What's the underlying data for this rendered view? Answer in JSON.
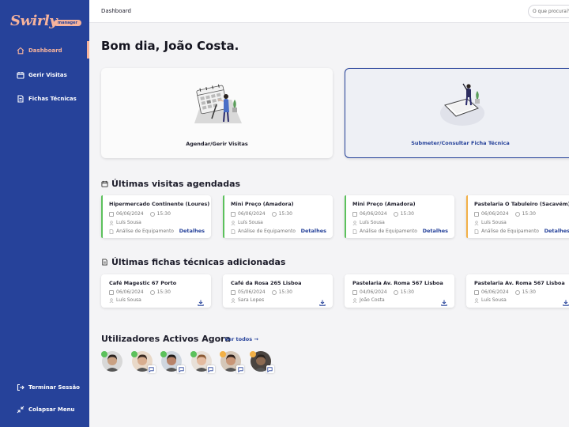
{
  "app": {
    "logo": "Swirly",
    "badge": "manager"
  },
  "colors": {
    "brand": "#26429a",
    "accent": "#f6b39c",
    "green": "#5cc15c",
    "orange": "#f2b046"
  },
  "sidebar": {
    "items": [
      {
        "label": "Dashboard",
        "icon": "home-icon"
      },
      {
        "label": "Gerir Visitas",
        "icon": "calendar-icon"
      },
      {
        "label": "Fichas Técnicas",
        "icon": "document-icon"
      }
    ],
    "logout": "Terminar Sessão",
    "collapse": "Colapsar Menu"
  },
  "topbar": {
    "breadcrumb": "Dashboard",
    "search_placeholder": "O que procura?"
  },
  "greeting": "Bom dia, João Costa.",
  "actions": [
    {
      "label": "Agendar/Gerir Visitas"
    },
    {
      "label": "Submeter/Consultar Ficha Técnica"
    }
  ],
  "visits": {
    "title": "Últimas visitas agendadas",
    "details_label": "Detalhes",
    "items": [
      {
        "name": "Hipermercado Continente (Loures)",
        "date": "06/06/2024",
        "time": "15:30",
        "person": "Luís Sousa",
        "type": "Análise de Equipamento",
        "status": "green"
      },
      {
        "name": "Mini Preço (Amadora)",
        "date": "06/06/2024",
        "time": "15:30",
        "person": "Luís Sousa",
        "type": "Análise de Equipamento",
        "status": "green"
      },
      {
        "name": "Mini Preço (Amadora)",
        "date": "06/06/2024",
        "time": "15:30",
        "person": "Luís Sousa",
        "type": "Análise de Equipamento",
        "status": "green"
      },
      {
        "name": "Pastelaria O Tabuleiro (Sacavém)",
        "date": "06/06/2024",
        "time": "15:30",
        "person": "Luís Sousa",
        "type": "Análise de Equipamento",
        "status": "orange"
      }
    ]
  },
  "sheets": {
    "title": "Últimas fichas técnicas adicionadas",
    "items": [
      {
        "name": "Café Magestic 67 Porto",
        "date": "06/06/2024",
        "time": "15:30",
        "person": "Luís Sousa"
      },
      {
        "name": "Café da Rosa 265 Lisboa",
        "date": "05/06/2024",
        "time": "15:30",
        "person": "Sara Lopes"
      },
      {
        "name": "Pastelaria Av. Roma 567 Lisboa",
        "date": "04/06/2024",
        "time": "15:30",
        "person": "João Costa"
      },
      {
        "name": "Pastelaria Av. Roma 567 Lisboa",
        "date": "06/06/2024",
        "time": "15:30",
        "person": "Luís Sousa"
      }
    ]
  },
  "users": {
    "title": "Utilizadores Activos Agora",
    "see_all": "Ver todos →",
    "avatars": [
      {
        "status": "green",
        "skin": "#c9a183",
        "hair": "#2a2320",
        "bg": "#d8d8d8"
      },
      {
        "status": "green",
        "skin": "#d8ad8f",
        "hair": "#3a2a22",
        "bg": "#e9d9c9"
      },
      {
        "status": "green",
        "skin": "#b7836a",
        "hair": "#1f1b1a",
        "bg": "#cfd6df"
      },
      {
        "status": "green",
        "skin": "#e4bba0",
        "hair": "#8a5a35",
        "bg": "#e8e0d8"
      },
      {
        "status": "orange",
        "skin": "#c99677",
        "hair": "#2e211c",
        "bg": "#d5c7b8"
      },
      {
        "status": "orange",
        "skin": "#8c6a52",
        "hair": "#2a2420",
        "bg": "#4a4440"
      }
    ]
  }
}
